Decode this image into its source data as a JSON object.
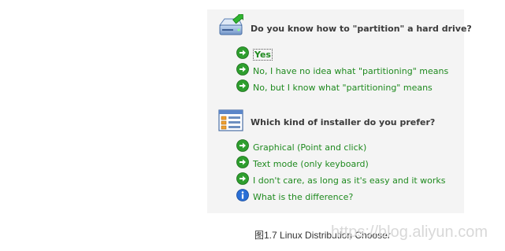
{
  "colors": {
    "panel_bg": "#f4f4f4",
    "option_text": "#1f8a1f",
    "question_text": "#3a3a3a",
    "arrow_icon": "#2e9e2e",
    "info_icon": "#2a6fd6"
  },
  "question1": {
    "text": "Do you know how to \"partition\" a hard drive?",
    "icon": "hard-drive-icon",
    "options": [
      {
        "label": "Yes",
        "icon": "green-arrow-icon",
        "selected": true
      },
      {
        "label": "No, I have no idea what \"partitioning\" means",
        "icon": "green-arrow-icon"
      },
      {
        "label": "No, but I know what \"partitioning\" means",
        "icon": "green-arrow-icon"
      }
    ]
  },
  "question2": {
    "text": "Which kind of installer do you prefer?",
    "icon": "installer-window-icon",
    "options": [
      {
        "label": "Graphical (Point and click)",
        "icon": "green-arrow-icon"
      },
      {
        "label": "Text mode (only keyboard)",
        "icon": "green-arrow-icon"
      },
      {
        "label": "I don't care, as long as it's easy and it works",
        "icon": "green-arrow-icon"
      },
      {
        "label": "What is the difference?",
        "icon": "info-icon"
      }
    ]
  },
  "caption": "图1.7    Linux Distribution Chooser",
  "watermark": "https://blog.aliyun.com"
}
